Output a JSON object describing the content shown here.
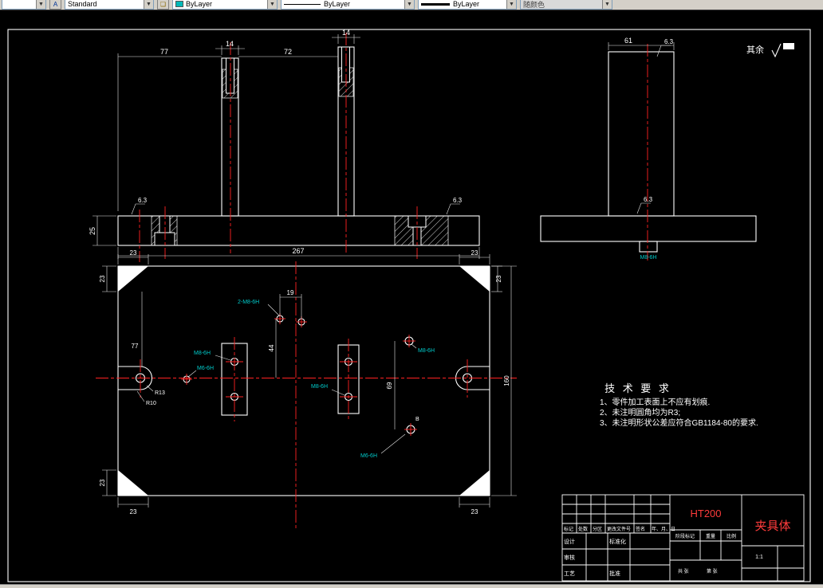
{
  "toolbar": {
    "style": "Standard",
    "color": "ByLayer",
    "linetype": "ByLayer",
    "lineweight": "ByLayer",
    "plot_style": "随颜色"
  },
  "annotations": {
    "surface_note": "其余",
    "finish": "6.3"
  },
  "front_view": {
    "dim_77": "77",
    "dim_14a": "14",
    "dim_72": "72",
    "dim_14b": "14",
    "dim_267": "267",
    "dim_25": "25"
  },
  "side_view": {
    "dim_61": "61",
    "thread_label": "M8-6H"
  },
  "plan_view": {
    "dim_23": "23",
    "dim_19": "19",
    "dim_44": "44",
    "dim_69": "69",
    "dim_77": "77",
    "dim_160": "160",
    "label_2m8": "2-M8-6H",
    "label_m8": "M8-6H",
    "label_m6": "M6-6H",
    "label_r13": "R13",
    "label_r10": "R10",
    "label_b": "B"
  },
  "tech_req": {
    "title": "技 术 要 求",
    "item1": "1、零件加工表面上不应有划痕.",
    "item2": "2、未注明圆角均为R3;",
    "item3": "3、未注明形状公差应符合GB1184-80的要求."
  },
  "title_block": {
    "material": "HT200",
    "part_name": "夹具体",
    "h_mark": "标记",
    "h_count": "处数",
    "h_zone": "分区",
    "h_doc": "更改文件号",
    "h_sign": "签名",
    "h_date": "年、月、日",
    "design": "设计",
    "standardize": "标准化",
    "review": "审核",
    "process": "工艺",
    "approve": "批准",
    "stage": "阶段标记",
    "weight": "重量",
    "scale": "比例",
    "scale_value": "1:1",
    "sheet_total": "共  张",
    "sheet_no": "第  张"
  }
}
